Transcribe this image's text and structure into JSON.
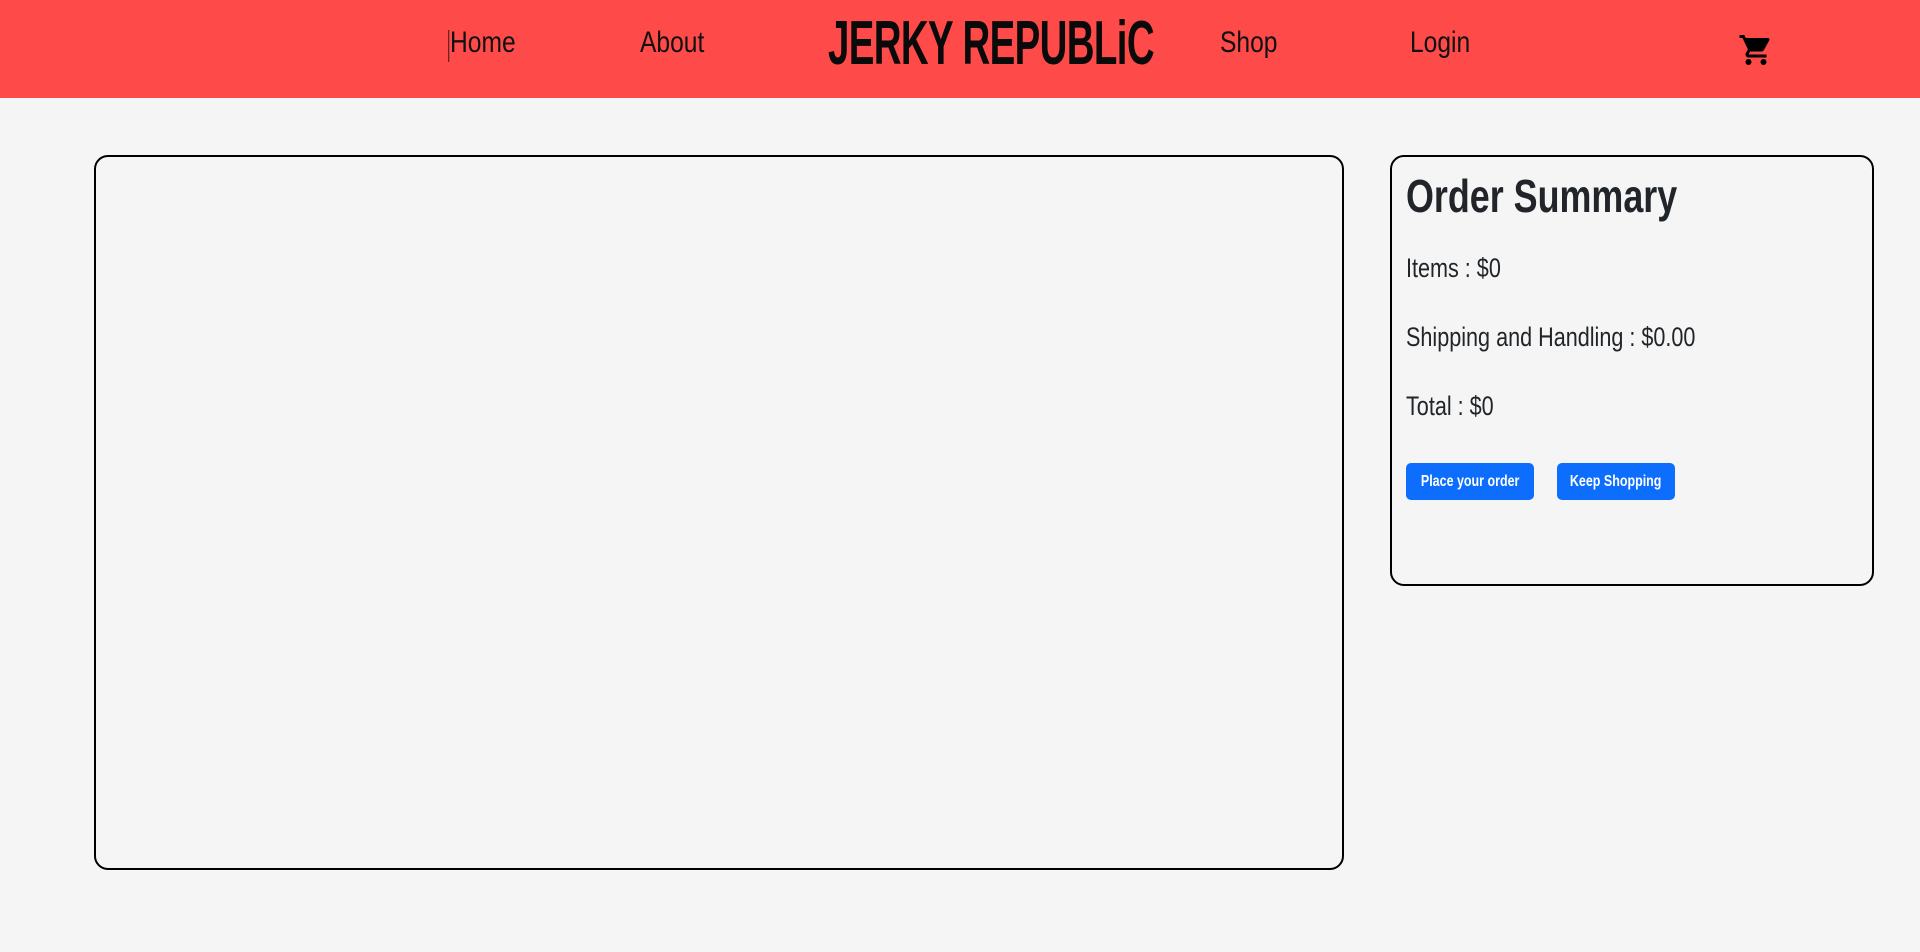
{
  "navbar": {
    "background": "#ff4a4a",
    "links": {
      "home": "Home",
      "about": "About",
      "shop": "Shop",
      "login": "Login"
    },
    "brand": "JERKY REPUBLiC",
    "cart_icon": "shopping-cart-icon"
  },
  "cart_panel": {
    "items": []
  },
  "summary": {
    "title": "Order Summary",
    "items_line": "Items : $0",
    "shipping_line": "Shipping and Handling : $0.00",
    "total_line": "Total : $0",
    "place_order_label": "Place your order",
    "keep_shopping_label": "Keep Shopping",
    "button_color": "#0d6efd"
  }
}
